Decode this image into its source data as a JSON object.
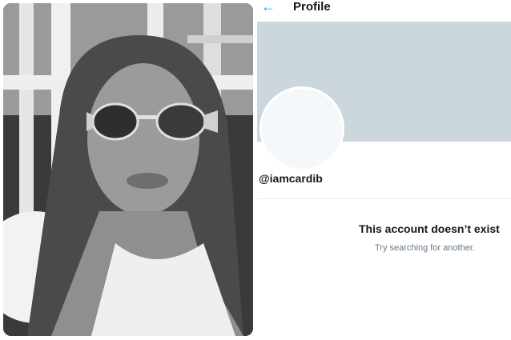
{
  "header": {
    "back_icon": "arrow-left-icon",
    "title": "Profile",
    "accent": "#1da1f2"
  },
  "profile": {
    "banner_color": "#ccd6dd",
    "handle": "@iamcardib"
  },
  "message": {
    "title": "This account doesn’t exist",
    "subtitle": "Try searching for another."
  }
}
